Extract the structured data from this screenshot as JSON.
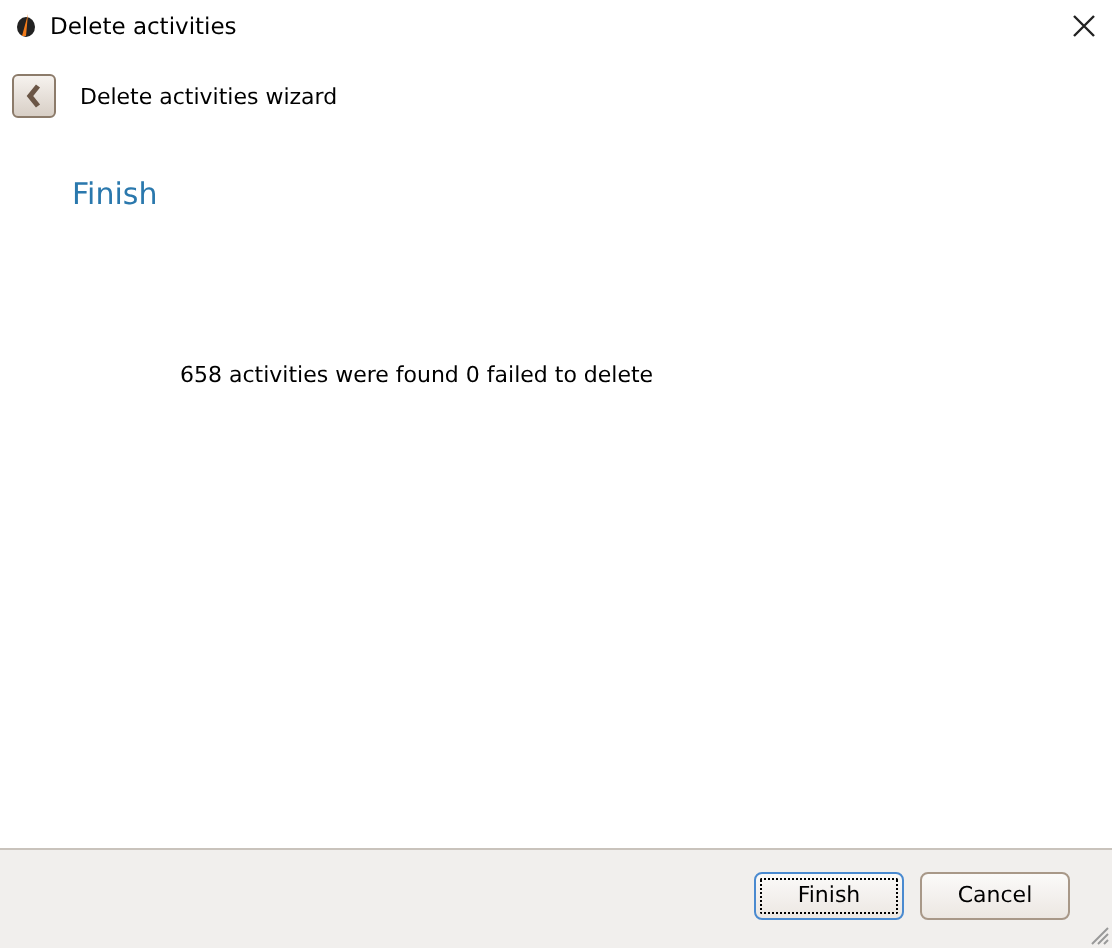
{
  "window": {
    "title": "Delete activities"
  },
  "header": {
    "title": "Delete activities wizard"
  },
  "page": {
    "heading": "Finish",
    "message": "658 activities were found 0 failed to delete"
  },
  "buttons": [
    {
      "label": "Finish",
      "default": true
    },
    {
      "label": "Cancel",
      "default": false
    }
  ]
}
